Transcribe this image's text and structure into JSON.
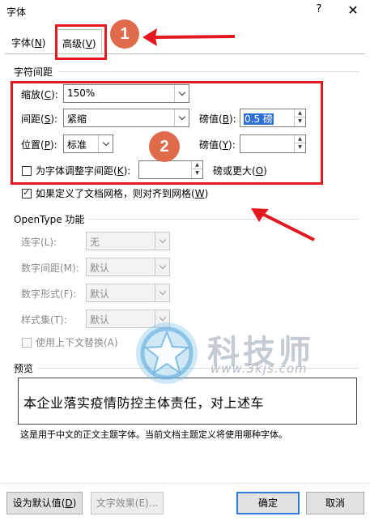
{
  "window": {
    "title": "字体",
    "help_label": "?",
    "close_label": "✕"
  },
  "tabs": [
    {
      "label": "字体",
      "hotkey": "N"
    },
    {
      "label": "高级",
      "hotkey": "V"
    }
  ],
  "char_spacing": {
    "section_title": "字符间距",
    "scale": {
      "label": "缩放",
      "hotkey": "C",
      "value": "150%"
    },
    "spacing": {
      "label": "间距",
      "hotkey": "S",
      "value": "紧缩",
      "by_label": "磅值",
      "by_hotkey": "B",
      "by_value": "0.5 磅"
    },
    "position": {
      "label": "位置",
      "hotkey": "P",
      "value": "标准",
      "by_label": "磅值",
      "by_hotkey": "Y",
      "by_value": ""
    },
    "kerning": {
      "label": "为字体调整字间距",
      "hotkey": "K",
      "value": "",
      "suffix": "磅或更大",
      "suffix_hotkey": "O",
      "checked": false
    },
    "grid": {
      "label": "如果定义了文档网格，则对齐到网格",
      "hotkey": "W",
      "checked": true
    }
  },
  "opentype": {
    "section_title": "OpenType 功能",
    "ligatures": {
      "label": "连字(L):",
      "value": "无"
    },
    "number_spacing": {
      "label": "数字间距(M):",
      "value": "默认"
    },
    "number_forms": {
      "label": "数字形式(F):",
      "value": "默认"
    },
    "stylistic_sets": {
      "label": "样式集(T):",
      "value": "默认"
    },
    "contextual": {
      "label": "使用上下文替换(A)",
      "checked": false
    }
  },
  "preview": {
    "section_title": "预览",
    "sample_text": "本企业落实疫情防控主体责任，对上述车",
    "note": "这是用于中文的正文主题字体。当前文档主题定义将使用哪种字体。"
  },
  "buttons": {
    "set_default": {
      "label": "设为默认值",
      "hotkey": "D"
    },
    "text_effects": {
      "label": "文字效果(E)..."
    },
    "ok": {
      "label": "确定"
    },
    "cancel": {
      "label": "取消"
    }
  },
  "annotations": {
    "badge1": "1",
    "badge2": "2",
    "color": "#e3191f",
    "badge_color": "#e06b4a"
  },
  "watermark": {
    "title": "科技师",
    "url": "www.3kjs.com"
  }
}
